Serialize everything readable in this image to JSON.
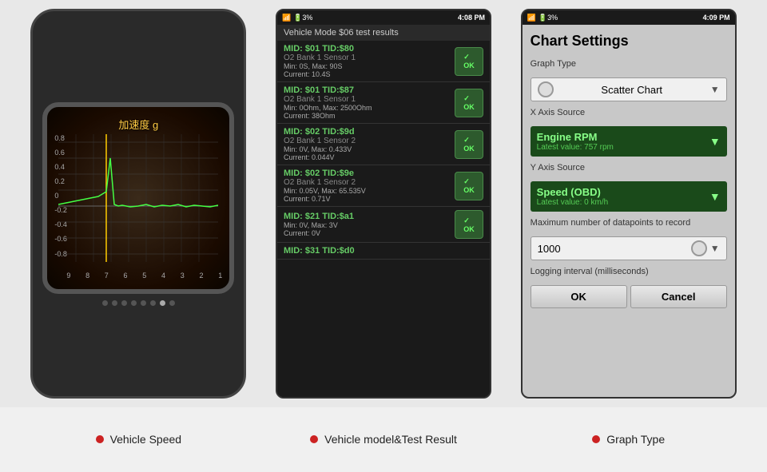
{
  "phone1": {
    "chart_title": "加速度 g",
    "y_labels": [
      "0.8",
      "0.6",
      "0.4",
      "0.2",
      "0",
      "-0.2",
      "-0.4",
      "-0.6",
      "-0.8"
    ],
    "x_labels": [
      "9",
      "8",
      "7",
      "6",
      "5",
      "4",
      "3",
      "2",
      "1"
    ],
    "dots": [
      false,
      false,
      false,
      false,
      false,
      false,
      true,
      false
    ]
  },
  "phone2": {
    "status_bar_left": "4:08 PM",
    "status_bar_right": "3%",
    "header": "Vehicle Mode $06 test results",
    "items": [
      {
        "title": "MID: $01 TID:$80",
        "subtitle": "O2 Bank 1 Sensor 1",
        "values": "Min: 0S, Max: 90S\nCurrent: 10.4S",
        "ok": true
      },
      {
        "title": "MID: $01 TID:$87",
        "subtitle": "O2 Bank 1 Sensor 1",
        "values": "Min: 0Ohm, Max: 2500Ohm\nCurrent: 38Ohm",
        "ok": true
      },
      {
        "title": "MID: $02 TID:$9d",
        "subtitle": "O2 Bank 1 Sensor 2",
        "values": "Min: 0V, Max: 0.433V\nCurrent: 0.044V",
        "ok": true
      },
      {
        "title": "MID: $02 TID:$9e",
        "subtitle": "O2 Bank 1 Sensor 2",
        "values": "Min: 0.05V, Max: 65.535V\nCurrent: 0.71V",
        "ok": true
      },
      {
        "title": "MID: $21 TID:$a1",
        "subtitle": "",
        "values": "Min: 0V, Max: 3V\nCurrent: 0V",
        "ok": true
      },
      {
        "title": "MID: $31 TID:$d0",
        "subtitle": "",
        "values": "",
        "ok": false
      }
    ]
  },
  "phone3": {
    "status_bar_left": "4:09 PM",
    "status_bar_right": "3%",
    "title": "Chart Settings",
    "graph_type_label": "Graph Type",
    "graph_type_value": "Scatter Chart",
    "x_axis_label": "X Axis Source",
    "x_axis_value": "Engine RPM",
    "x_axis_sub": "Latest value: 757 rpm",
    "y_axis_label": "Y Axis Source",
    "y_axis_value": "Speed (OBD)",
    "y_axis_sub": "Latest value: 0 km/h",
    "max_datapoints_label": "Maximum number of datapoints to record",
    "max_datapoints_value": "1000",
    "logging_label": "Logging interval (milliseconds)",
    "ok_btn": "OK",
    "cancel_btn": "Cancel"
  },
  "labels": [
    {
      "dot": true,
      "text": "Vehicle Speed"
    },
    {
      "dot": true,
      "text": "Vehicle model&Test Result"
    },
    {
      "dot": true,
      "text": "Graph Type"
    }
  ]
}
